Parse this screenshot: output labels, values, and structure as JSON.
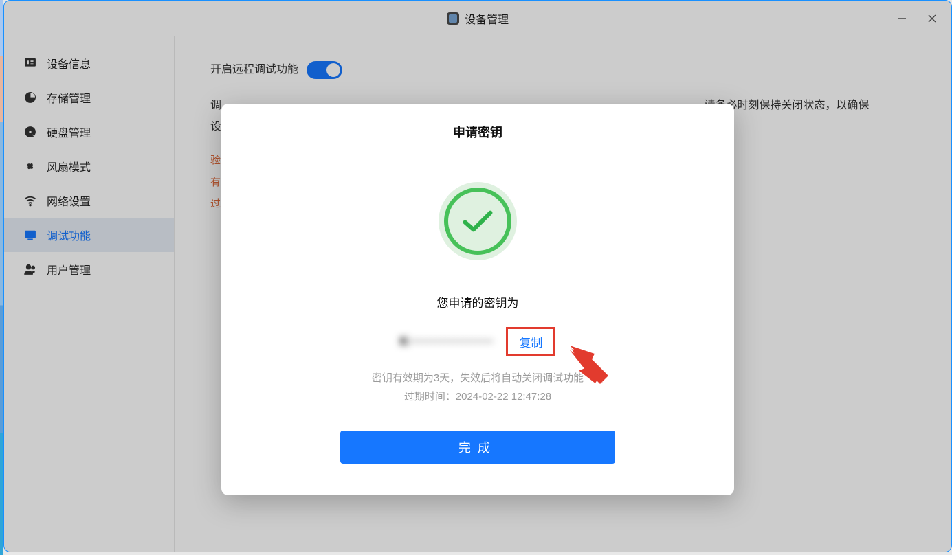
{
  "window": {
    "title": "设备管理"
  },
  "sidebar": {
    "items": [
      {
        "label": "设备信息",
        "icon": "device-info"
      },
      {
        "label": "存储管理",
        "icon": "storage"
      },
      {
        "label": "硬盘管理",
        "icon": "disk"
      },
      {
        "label": "风扇模式",
        "icon": "fan"
      },
      {
        "label": "网络设置",
        "icon": "network"
      },
      {
        "label": "调试功能",
        "icon": "debug",
        "active": true
      },
      {
        "label": "用户管理",
        "icon": "users"
      }
    ]
  },
  "main": {
    "toggle_label": "开启远程调试功能",
    "toggle_on": true,
    "desc_visible_tail": "请务必时刻保持关闭状态，以确保",
    "warn_head_chars": [
      "验",
      "有",
      "过"
    ]
  },
  "modal": {
    "title": "申请密钥",
    "key_label": "您申请的密钥为",
    "key_value": "K···················",
    "copy_label": "复制",
    "note_line1": "密钥有效期为3天，失效后将自动关闭调试功能",
    "note_line2": "过期时间：2024-02-22 12:47:28",
    "done_label": "完成"
  }
}
